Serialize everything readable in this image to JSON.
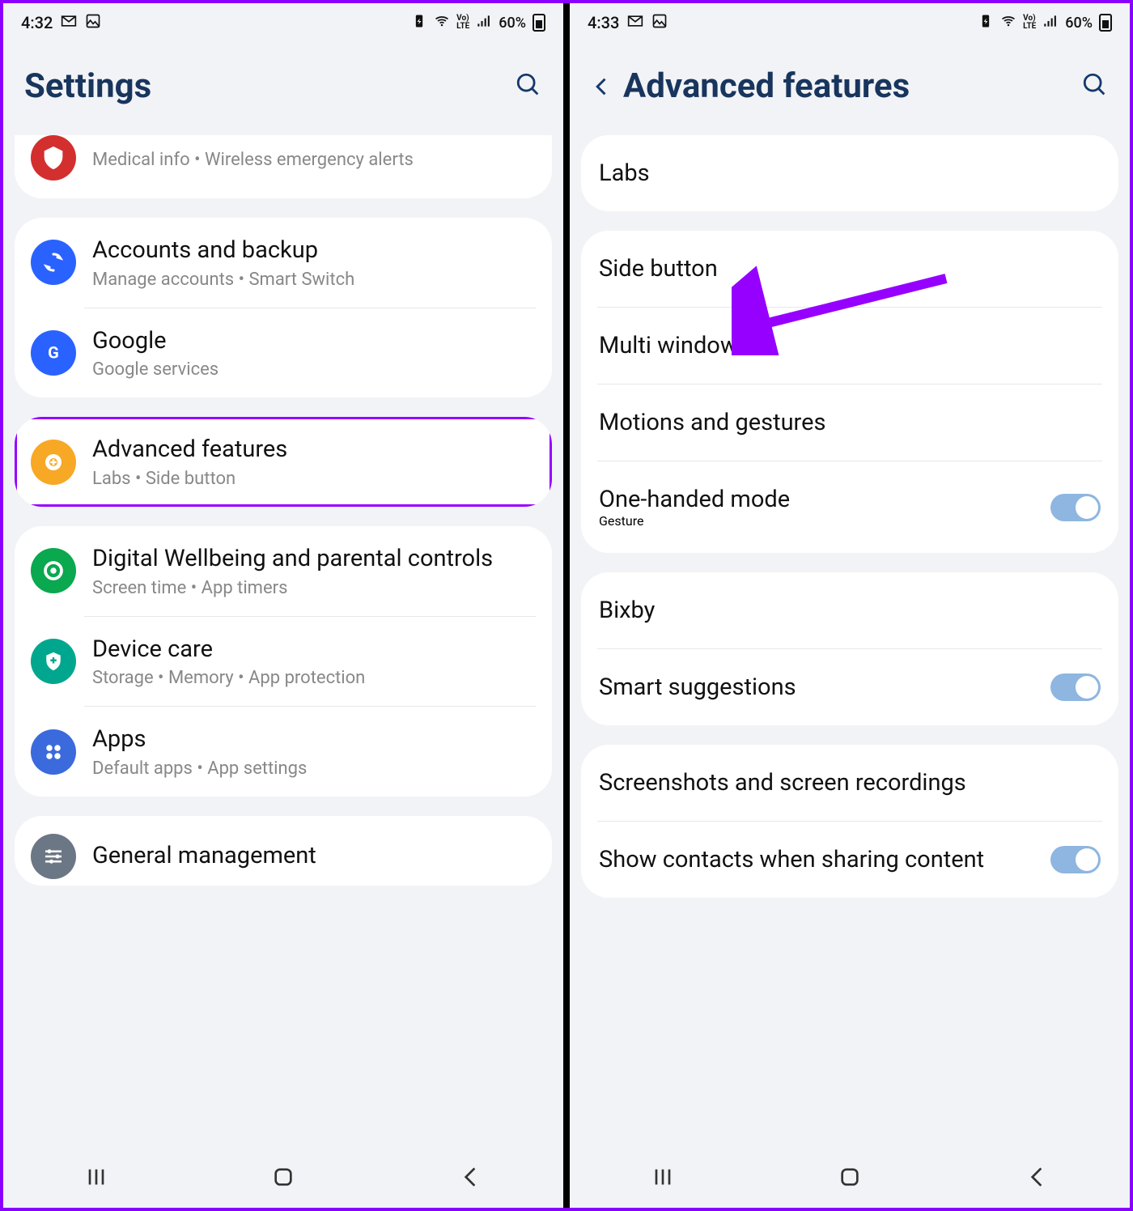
{
  "left": {
    "status": {
      "time": "4:32",
      "battery": "60%"
    },
    "header": {
      "title": "Settings"
    },
    "row_partial": {
      "sub": "Medical info  •  Wireless emergency alerts"
    },
    "group1": [
      {
        "title": "Accounts and backup",
        "sub": "Manage accounts  •  Smart Switch"
      },
      {
        "title": "Google",
        "sub": "Google services"
      }
    ],
    "group2": [
      {
        "title": "Advanced features",
        "sub": "Labs  •  Side button"
      }
    ],
    "group3": [
      {
        "title": "Digital Wellbeing and parental controls",
        "sub": "Screen time  •  App timers"
      },
      {
        "title": "Device care",
        "sub": "Storage  •  Memory  •  App protection"
      },
      {
        "title": "Apps",
        "sub": "Default apps  •  App settings"
      }
    ],
    "group4": [
      {
        "title": "General management"
      }
    ]
  },
  "right": {
    "status": {
      "time": "4:33",
      "battery": "60%"
    },
    "header": {
      "title": "Advanced features"
    },
    "group1": [
      {
        "title": "Labs"
      }
    ],
    "group2": [
      {
        "title": "Side button"
      },
      {
        "title": "Multi window"
      },
      {
        "title": "Motions and gestures"
      },
      {
        "title": "One-handed mode",
        "sub_blue": "Gesture",
        "toggle": true
      }
    ],
    "group3": [
      {
        "title": "Bixby"
      },
      {
        "title": "Smart suggestions",
        "toggle": true
      }
    ],
    "group4": [
      {
        "title": "Screenshots and screen recordings"
      },
      {
        "title": "Show contacts when sharing content",
        "toggle": true
      }
    ]
  }
}
